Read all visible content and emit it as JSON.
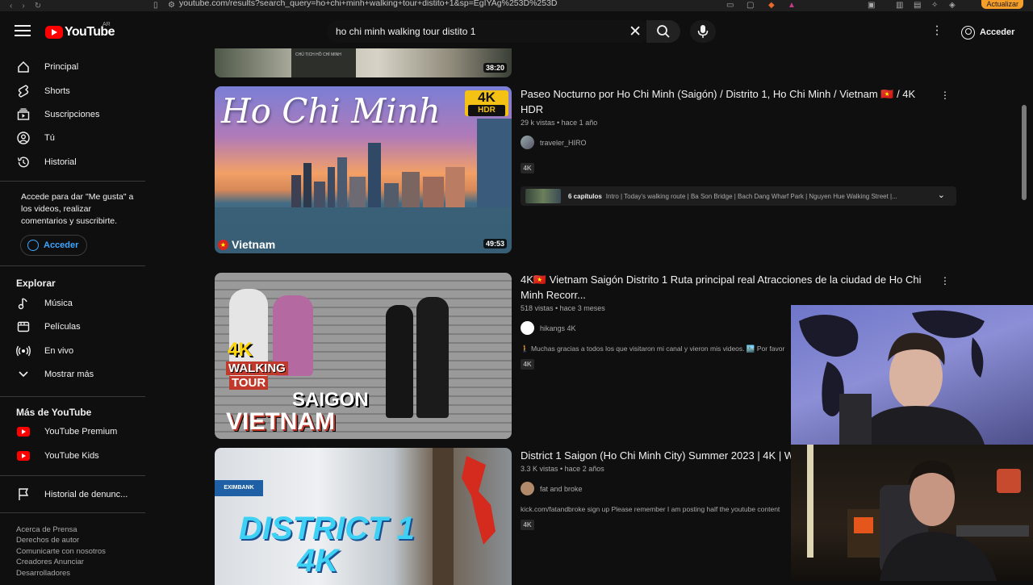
{
  "browser": {
    "url": "youtube.com/results?search_query=ho+chi+minh+walking+tour+distito+1&sp=EgIYAg%253D%253D",
    "update_label": "Actualizar"
  },
  "header": {
    "logo_text": "YouTube",
    "region": "AR",
    "search_value": "ho chi minh walking tour distito 1",
    "signin_label": "Acceder"
  },
  "sidebar": {
    "items": [
      {
        "label": "Principal"
      },
      {
        "label": "Shorts"
      },
      {
        "label": "Suscripciones"
      },
      {
        "label": "Tú"
      },
      {
        "label": "Historial"
      }
    ],
    "signin_note": "Accede para dar \"Me gusta\" a los videos, realizar comentarios y suscribirte.",
    "signin_button": "Acceder",
    "explore_heading": "Explorar",
    "explore": [
      {
        "label": "Música"
      },
      {
        "label": "Películas"
      },
      {
        "label": "En vivo"
      },
      {
        "label": "Mostrar más"
      }
    ],
    "more_heading": "Más de YouTube",
    "more": [
      {
        "label": "YouTube Premium"
      },
      {
        "label": "YouTube Kids"
      }
    ],
    "report_history": "Historial de denunc...",
    "footer_lines": [
      "Acerca de  Prensa",
      "Derechos de autor",
      "Comunicarte con nosotros",
      "Creadores  Anunciar",
      "Desarrolladores"
    ]
  },
  "results": [
    {
      "duration": "38:20",
      "thumb_caption": "CHỦ TỊCH HỒ CHÍ MINH"
    },
    {
      "title": "Paseo Nocturno por Ho Chi Minh (Saigón) / Distrito 1, Ho Chi Minh / Vietnam 🇻🇳 / 4K HDR",
      "meta": "29 k vistas • hace 1 año",
      "channel": "traveler_HIRO",
      "badge": "4K",
      "duration": "49:53",
      "thumb_title": "Ho Chi Minh",
      "thumb_hdr_top": "4K",
      "thumb_hdr_bottom": "HDR",
      "thumb_country": "Vietnam",
      "chapters_label": "6 capítulos",
      "chapters_text": "Intro | Today's walking route | Ba Son Bridge | Bach Dang Wharf Park | Nguyen Hue Walking Street |..."
    },
    {
      "title": "4K🇻🇳 Vietnam Saigón Distrito 1 Ruta principal real Atracciones de la ciudad de Ho Chi Minh Recorr...",
      "meta": "518 vistas • hace 3 meses",
      "channel": "hikangs 4K",
      "description": "🚶 Muchas gracias a todos los que visitaron mi canal y vieron mis videos. 🏙️ Por favor",
      "badge": "4K",
      "thumb_line1": "4K",
      "thumb_line2": "WALKING",
      "thumb_line3": "TOUR",
      "thumb_line4": "SAIGON",
      "thumb_line5": "VIETNAM"
    },
    {
      "title": "District 1 Saigon (Ho Chi Minh City) Summer 2023 | 4K | W",
      "meta": "3.3 K vistas • hace 2 años",
      "channel": "fat and broke",
      "description": "kick.com/fatandbroke sign up Please remember I am posting half the youtube content",
      "badge": "4K",
      "thumb_line1": "DISTRICT 1",
      "thumb_line2": "4K",
      "thumb_sign": "EXIMBANK"
    }
  ],
  "colors": {
    "background": "#0f0f0f",
    "accent": "#ff0000",
    "link": "#3ea6ff"
  }
}
